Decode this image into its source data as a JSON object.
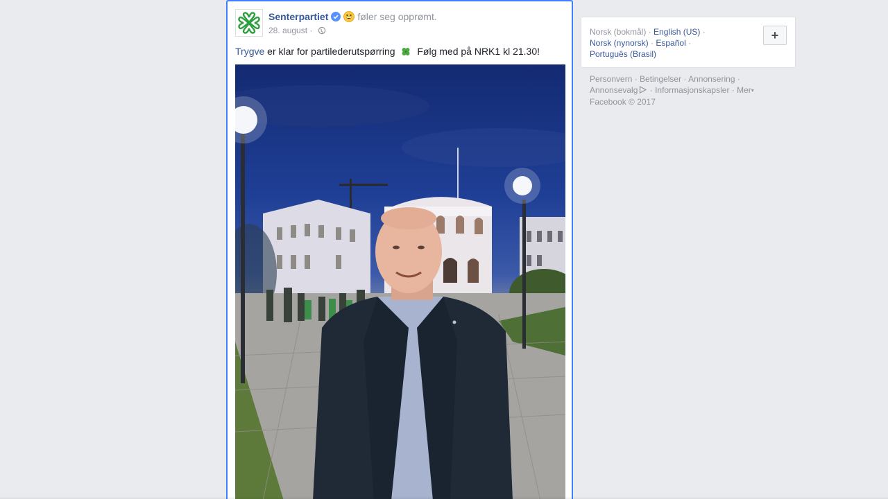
{
  "post": {
    "page_name": "Senterpartiet",
    "feeling": "føler seg opprømt.",
    "date": "28. august",
    "date_separator": " · ",
    "mention": "Trygve",
    "text": " er klar for partilederutspørring ",
    "text_after": " Følg med på NRK1 kl 21.30!"
  },
  "sidebar": {
    "languages": [
      {
        "label": "Norsk (bokmål)",
        "current": true
      },
      {
        "label": "English (US)",
        "current": false
      },
      {
        "label": "Norsk (nynorsk)",
        "current": false
      },
      {
        "label": "Español",
        "current": false
      },
      {
        "label": "Português (Brasil)",
        "current": false
      }
    ],
    "add_button_label": "+",
    "footer": {
      "privacy": "Personvern",
      "terms": "Betingelser",
      "advertising": "Annonsering",
      "adchoices": "Annonsevalg",
      "cookies": "Informasjonskapsler",
      "more": "Mer",
      "copyright": "Facebook © 2017"
    }
  },
  "colors": {
    "link": "#365899",
    "muted": "#90949c",
    "focus_border": "#4080ff",
    "background": "#e9ebee"
  }
}
